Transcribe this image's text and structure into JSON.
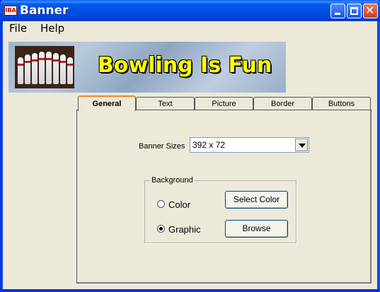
{
  "window": {
    "title": "Banner",
    "app_icon_text": "IBA"
  },
  "menu": {
    "items": [
      "File",
      "Help"
    ]
  },
  "banner": {
    "text": "Bowling Is Fun"
  },
  "tabs": [
    {
      "label": "General",
      "active": true
    },
    {
      "label": "Text",
      "active": false
    },
    {
      "label": "Picture",
      "active": false
    },
    {
      "label": "Border",
      "active": false
    },
    {
      "label": "Buttons",
      "active": false
    }
  ],
  "general": {
    "banner_sizes_label": "Banner Sizes",
    "banner_sizes_value": "392 x 72",
    "background_group": {
      "legend": "Background",
      "options": [
        {
          "label": "Color",
          "checked": false
        },
        {
          "label": "Graphic",
          "checked": true
        }
      ],
      "select_color_button": "Select Color",
      "browse_button": "Browse"
    }
  }
}
